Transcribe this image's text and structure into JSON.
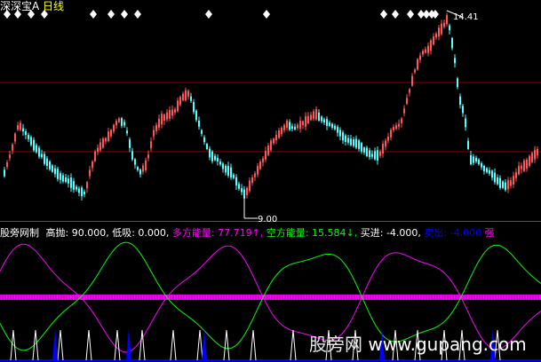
{
  "main_chart": {
    "title_symbol": "深深宝A",
    "title_period": "日线",
    "high_label": "14.41",
    "low_label": "9.00"
  },
  "indicator": {
    "name": "股旁网制",
    "high_throw": "高抛: 90.000,",
    "low_buy": "低吸: 0.000,",
    "bull_energy_label": "多方能量:",
    "bull_energy_value": "77.719↑,",
    "bear_energy_label": "空方能量:",
    "bear_energy_value": "15.584↓,",
    "buy": "买进: -4.000,",
    "sell_label": "卖出:",
    "sell_value": "-4.000",
    "strong": "强"
  },
  "watermark": {
    "name": "股旁网",
    "url": "www.gupang.com"
  },
  "colors": {
    "title": "#ffffff",
    "period": "#ffff00",
    "bull": "#ff00ff",
    "bear": "#00ff00",
    "sell": "#0000ff",
    "grid": "#8b0000",
    "candle_up": "#ff5555",
    "candle_down": "#55ffff",
    "band": "#ff00ff"
  },
  "chart_data": {
    "type": "candlestick",
    "price_high": 14.41,
    "price_low": 9.0
  }
}
